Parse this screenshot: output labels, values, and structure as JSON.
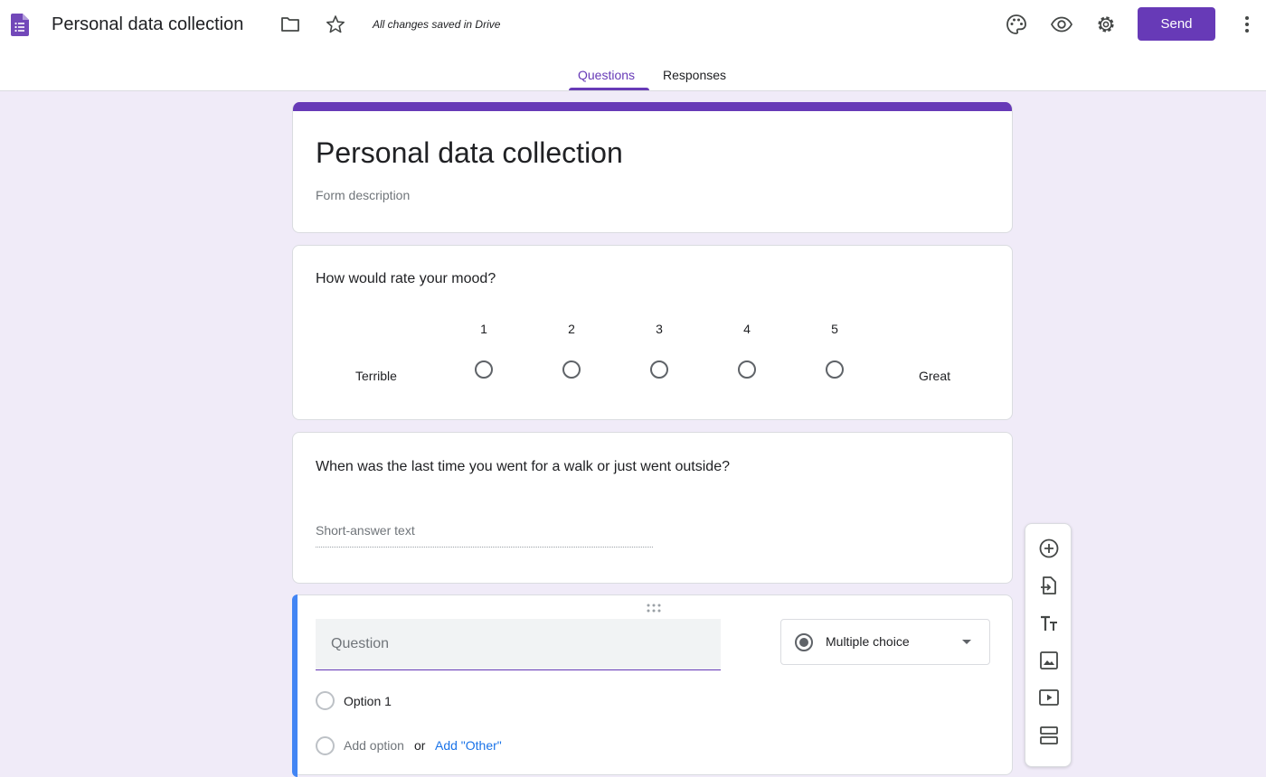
{
  "app": {
    "title": "Personal data collection",
    "save_status": "All changes saved in Drive",
    "send_label": "Send",
    "brand_color": "#673ab7"
  },
  "header_icons": [
    "forms-logo-icon",
    "folder-icon",
    "star-icon",
    "palette-icon",
    "preview-eye-icon",
    "settings-gear-icon",
    "more-vert-icon"
  ],
  "tabs": [
    {
      "label": "Questions",
      "active": true
    },
    {
      "label": "Responses",
      "active": false
    }
  ],
  "form": {
    "title": "Personal data collection",
    "description": "Form description"
  },
  "questions": [
    {
      "type": "linear-scale",
      "title": "How would rate your mood?",
      "scale": [
        "1",
        "2",
        "3",
        "4",
        "5"
      ],
      "low_label": "Terrible",
      "high_label": "Great"
    },
    {
      "type": "short-answer",
      "title": "When was the last time you went for a walk or just went outside?",
      "placeholder": "Short-answer text"
    },
    {
      "type": "multiple-choice",
      "active": true,
      "question_placeholder": "Question",
      "type_label": "Multiple choice",
      "options": [
        "Option 1"
      ],
      "add_option": "Add option",
      "or_text": "or",
      "add_other": "Add \"Other\""
    }
  ],
  "side_toolbar": [
    "add-question-icon",
    "import-questions-icon",
    "add-title-icon",
    "add-image-icon",
    "add-video-icon",
    "add-section-icon"
  ]
}
